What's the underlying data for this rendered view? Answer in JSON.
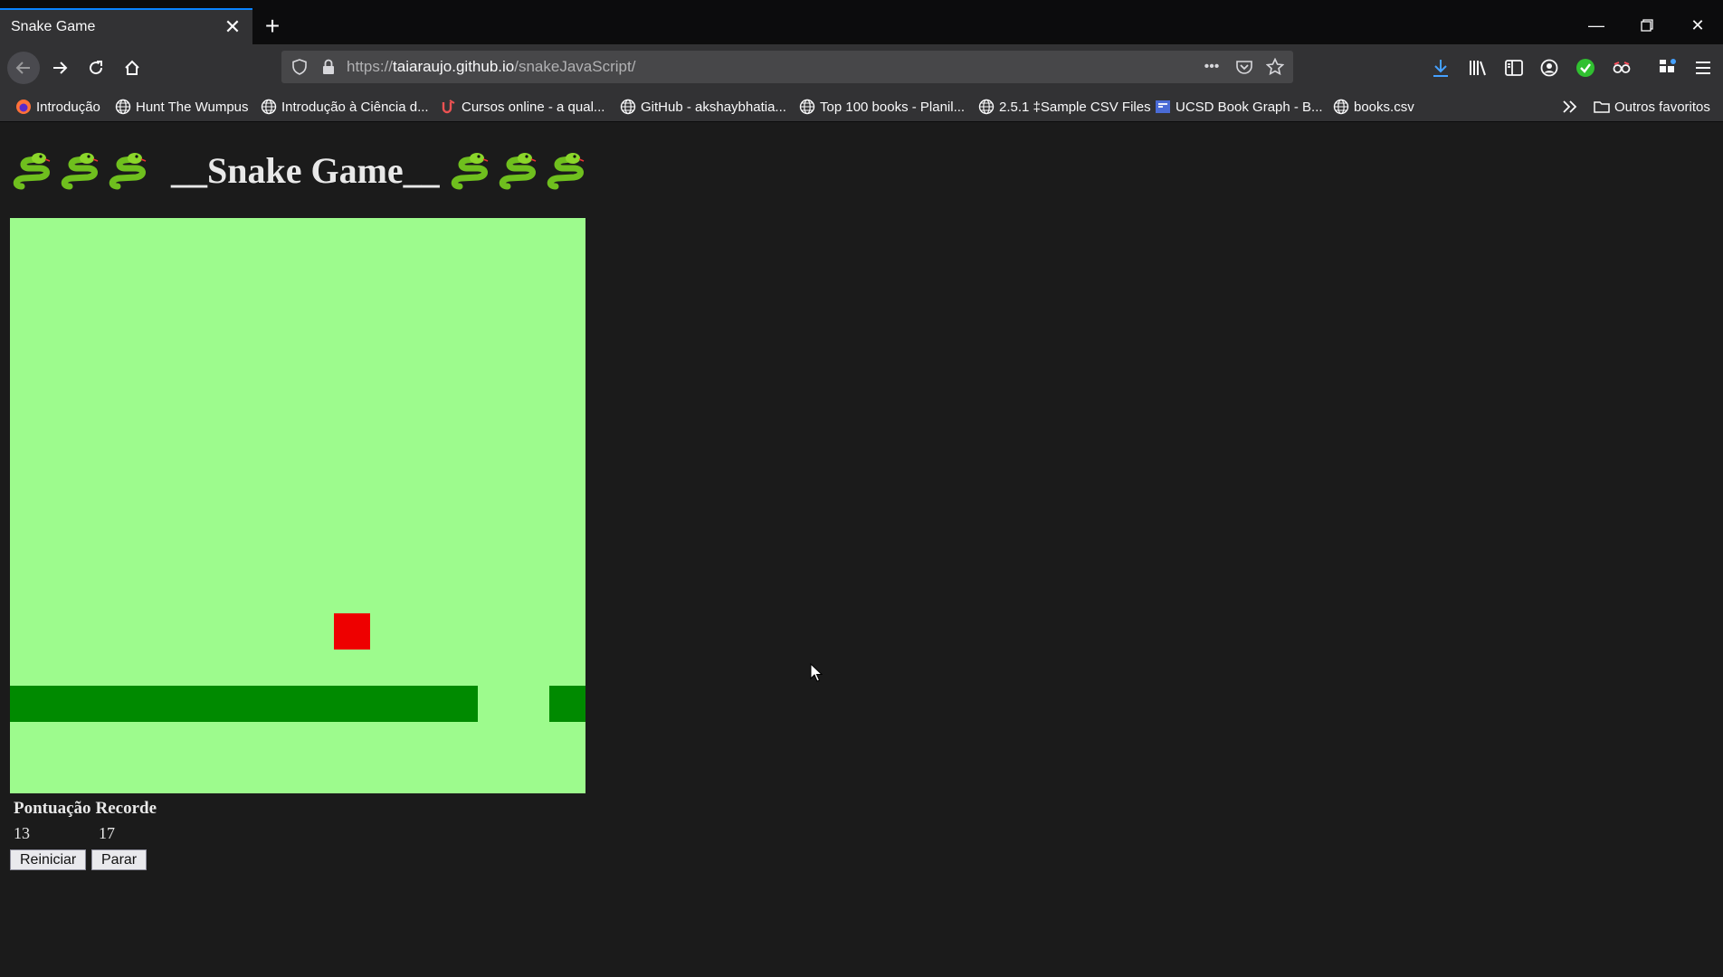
{
  "browser": {
    "tab_title": "Snake Game",
    "url_prefix": "https://",
    "url_domain": "taiaraujo.github.io",
    "url_path": "/snakeJavaScript/",
    "bookmarks": [
      {
        "label": "Introdução",
        "icon": "firefox-icon"
      },
      {
        "label": "Hunt The Wumpus",
        "icon": "globe-icon"
      },
      {
        "label": "Introdução à Ciência d...",
        "icon": "globe-icon"
      },
      {
        "label": "Cursos online - a qual...",
        "icon": "udemy-icon"
      },
      {
        "label": "GitHub - akshaybhatia...",
        "icon": "globe-icon"
      },
      {
        "label": "Top 100 books - Planil...",
        "icon": "globe-icon"
      },
      {
        "label": "2.5.1 ‡Sample CSV Files",
        "icon": "globe-icon"
      },
      {
        "label": "UCSD Book Graph - B...",
        "icon": "ucsd-icon"
      },
      {
        "label": "books.csv",
        "icon": "globe-icon"
      }
    ],
    "other_bookmarks": "Outros favoritos",
    "colors": {
      "accent": "#0a84ff",
      "chrome": "#323234",
      "titlebar": "#0c0c0d"
    }
  },
  "game": {
    "title": "__Snake Game__",
    "grid_size": 16,
    "colors": {
      "board": "#9dfb8d",
      "snake": "#008a00",
      "food": "#ee0000"
    },
    "food": {
      "col": 9,
      "row": 11
    },
    "snake_cells": [
      [
        0,
        13
      ],
      [
        1,
        13
      ],
      [
        2,
        13
      ],
      [
        3,
        13
      ],
      [
        4,
        13
      ],
      [
        5,
        13
      ],
      [
        6,
        13
      ],
      [
        7,
        13
      ],
      [
        8,
        13
      ],
      [
        9,
        13
      ],
      [
        10,
        13
      ],
      [
        11,
        13
      ],
      [
        12,
        13
      ],
      [
        15,
        13
      ]
    ],
    "score_label": "Pontuação",
    "record_label": "Recorde",
    "score": "13",
    "record": "17",
    "restart_label": "Reiniciar",
    "stop_label": "Parar"
  }
}
